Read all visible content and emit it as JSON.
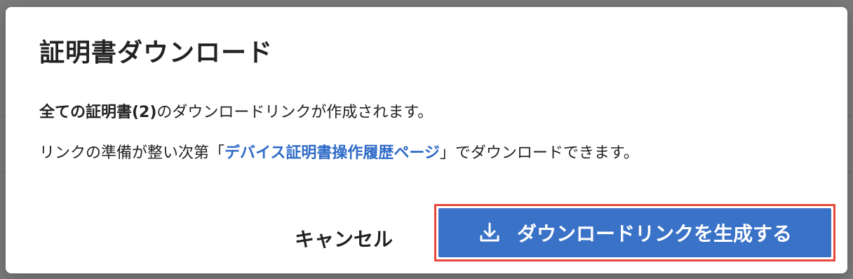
{
  "dialog": {
    "title": "証明書ダウンロード",
    "message_line1": {
      "bold_part": "全ての証明書(2)",
      "rest": "のダウンロードリンクが作成されます。"
    },
    "message_line2": {
      "before": "リンクの準備が整い次第「",
      "link_text": "デバイス証明書操作履歴ページ",
      "after": "」でダウンロードできます。"
    },
    "cancel_label": "キャンセル",
    "generate_label": "ダウンロードリンクを生成する",
    "generate_icon": "download-icon"
  },
  "colors": {
    "primary": "#3a72c8",
    "link": "#2f6bc8",
    "focus_ring": "#e8473a",
    "backdrop": "#7a7a7a"
  }
}
